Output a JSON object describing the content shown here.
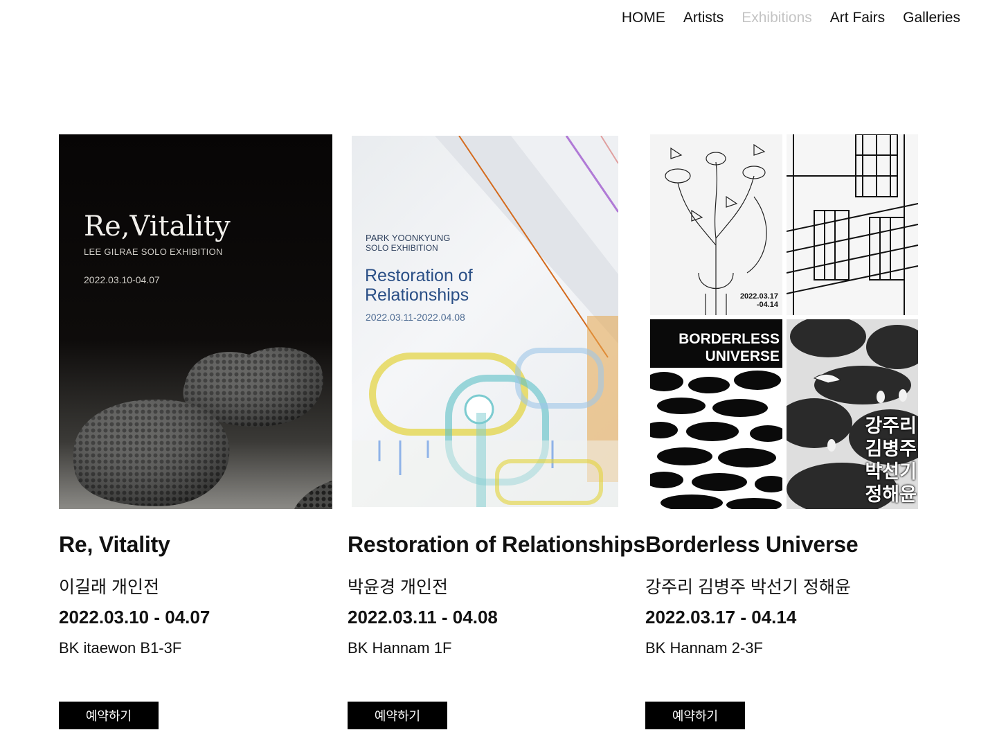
{
  "nav": {
    "items": [
      "HOME",
      "Artists",
      "Exhibitions",
      "Art Fairs",
      "Galleries"
    ],
    "active": "Exhibitions"
  },
  "exhibitions": [
    {
      "title": "Re, Vitality",
      "subtitle": "이길래 개인전",
      "dates": "2022.03.10 - 04.07",
      "venue": "BK itaewon B1-3F",
      "button": "예약하기",
      "poster": {
        "title": "Re,Vitality",
        "subtitle": "LEE GILRAE  SOLO EXHIBITION",
        "date": "2022.03.10-04.07"
      }
    },
    {
      "title": "Restoration of Relationships",
      "subtitle": "박윤경 개인전",
      "dates": "2022.03.11 - 04.08",
      "venue": "BK Hannam 1F",
      "button": "예약하기",
      "poster": {
        "artist": "PARK YOONKYUNG",
        "label": "SOLO EXHIBITION",
        "title_line1": "Restoration of",
        "title_line2": "Relationships",
        "date": "2022.03.11-2022.04.08"
      }
    },
    {
      "title": "Borderless Universe",
      "subtitle": "강주리 김병주 박선기 정해윤",
      "dates": "2022.03.17 - 04.14",
      "venue": "BK Hannam 2-3F",
      "button": "예약하기",
      "poster": {
        "date": "2022.03.17\n-04.14",
        "title": "BORDERLESS\nUNIVERSE",
        "names": "강주리\n김병주\n박선기\n정해윤"
      }
    }
  ]
}
